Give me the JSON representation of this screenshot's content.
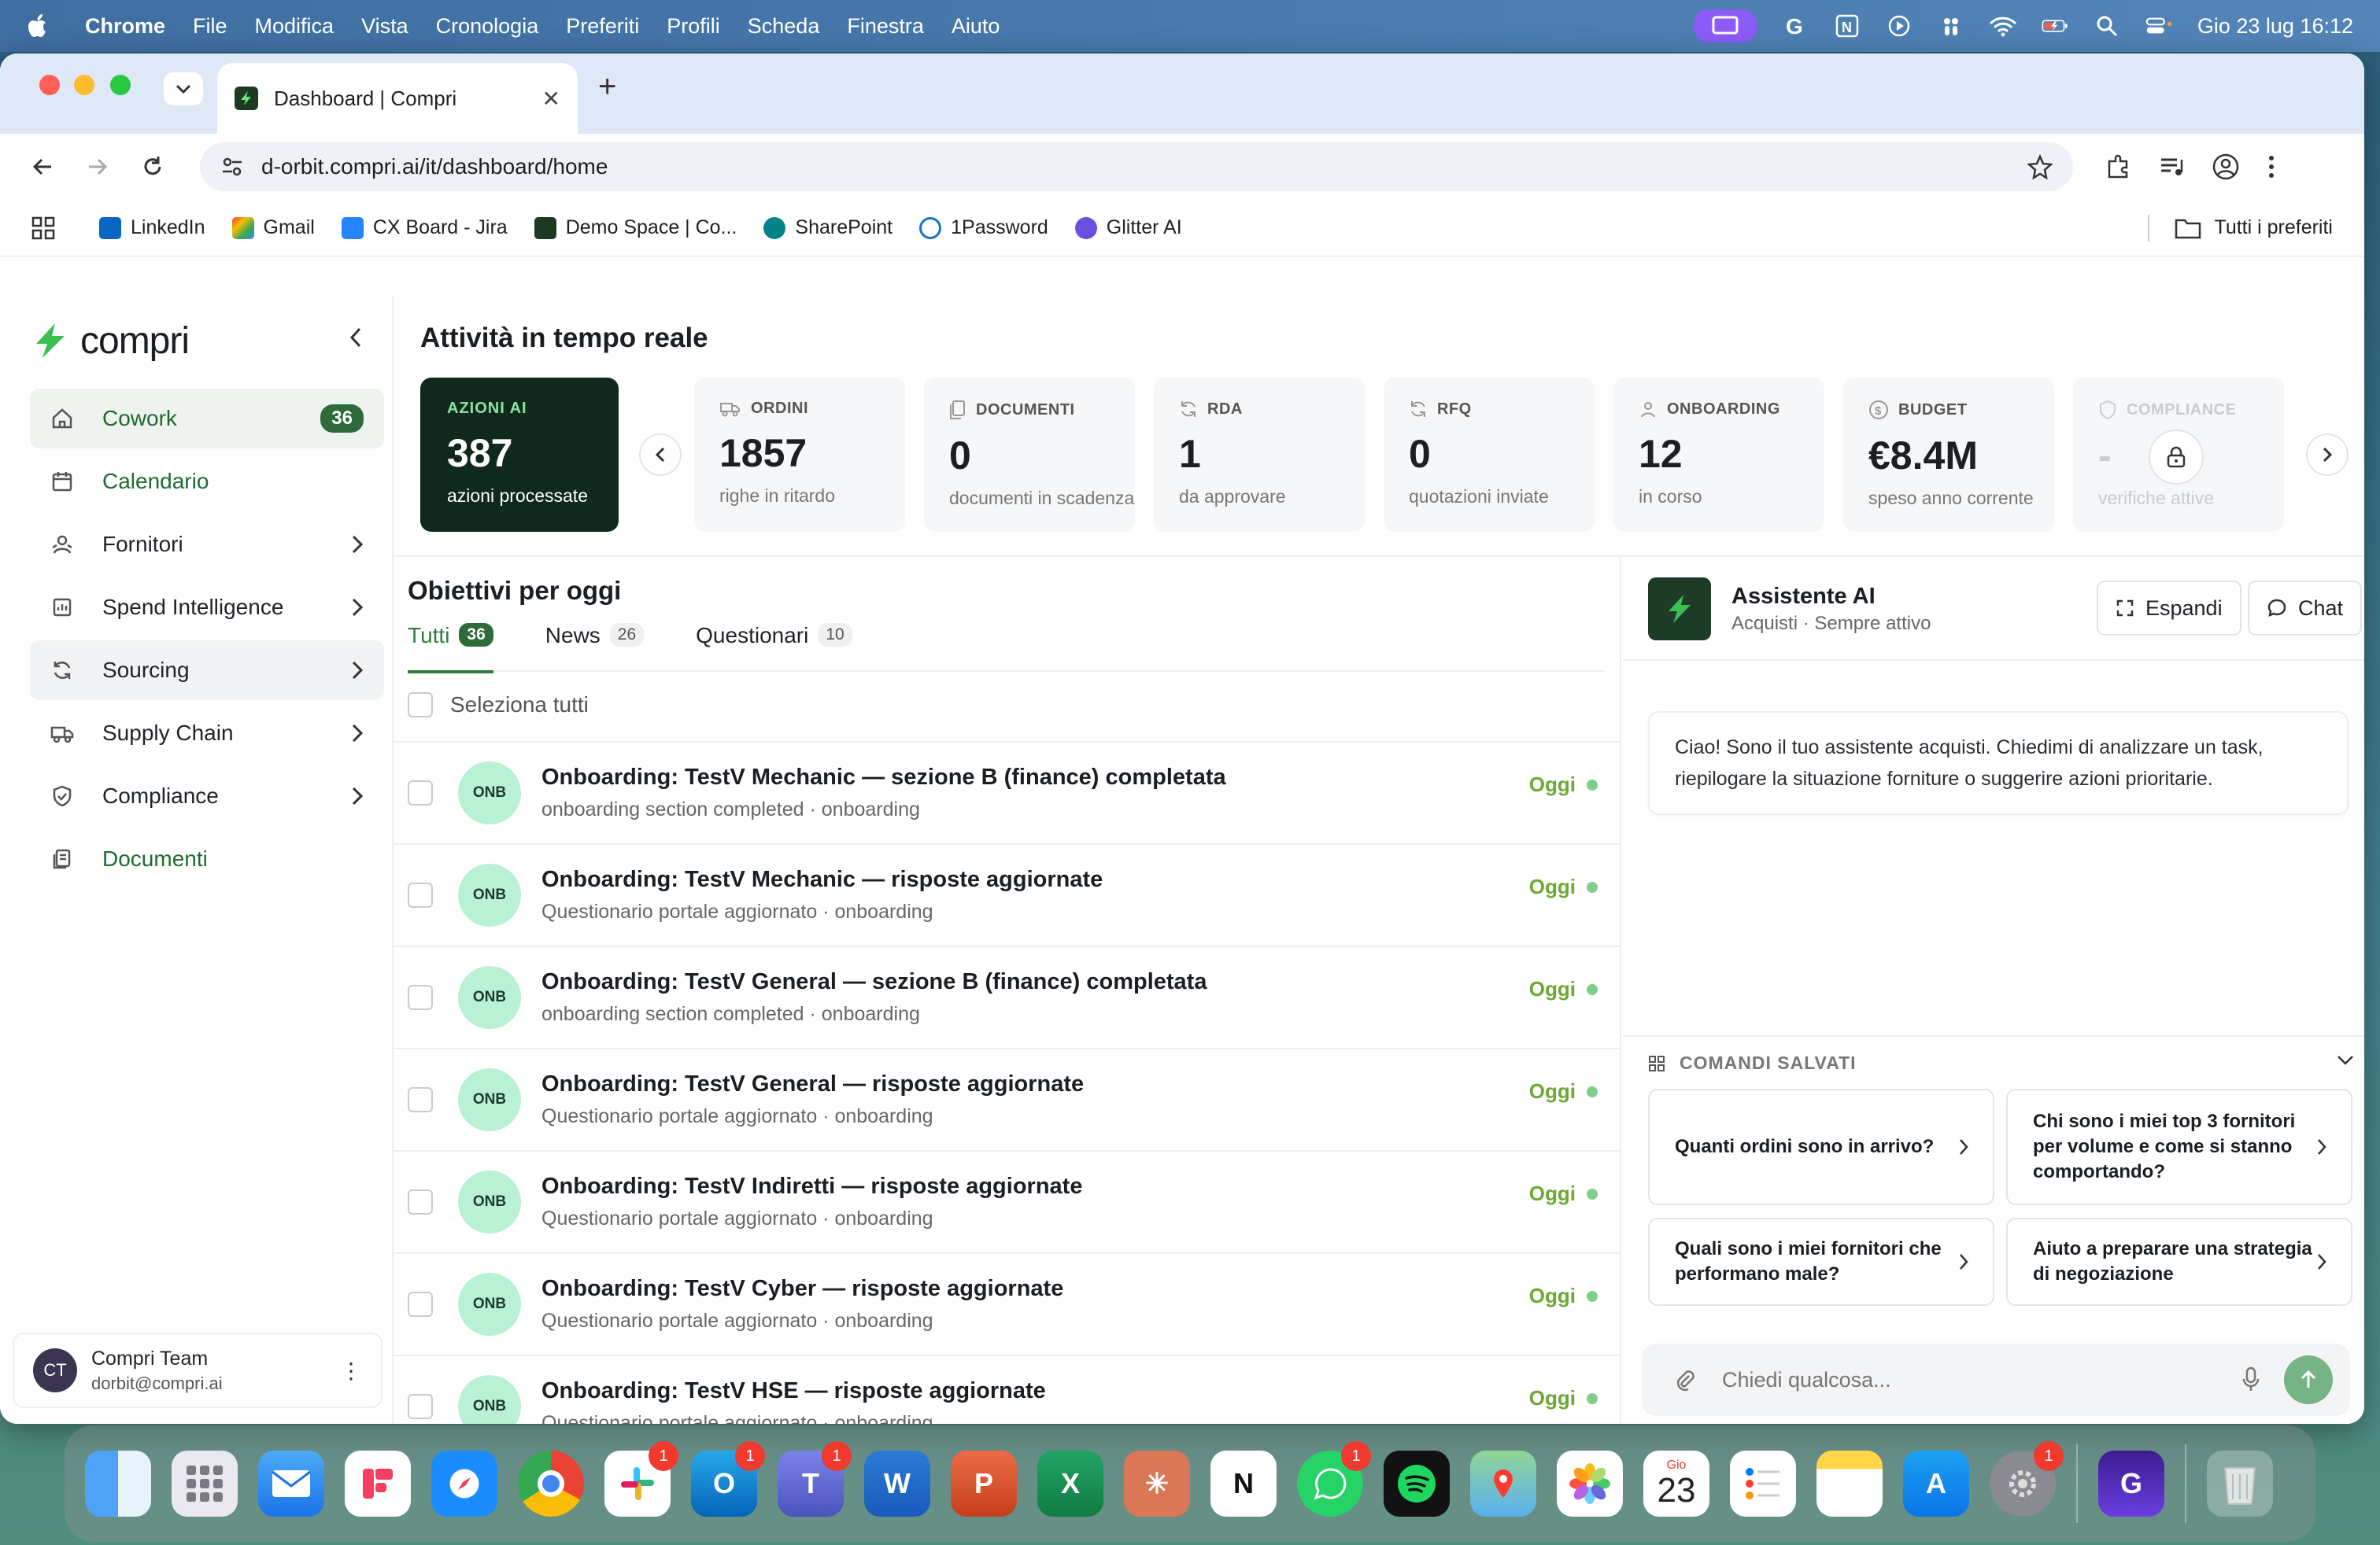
{
  "menubar": {
    "app": "Chrome",
    "items": [
      "File",
      "Modifica",
      "Vista",
      "Cronologia",
      "Preferiti",
      "Profili",
      "Scheda",
      "Finestra",
      "Aiuto"
    ],
    "clock": "Gio 23 lug  16:12"
  },
  "browser": {
    "tab_title": "Dashboard | Compri",
    "url": "d-orbit.compri.ai/it/dashboard/home",
    "bookmarks": [
      "LinkedIn",
      "Gmail",
      "CX Board - Jira",
      "Demo Space | Co...",
      "SharePoint",
      "1Password",
      "Glitter AI"
    ],
    "all_bookmarks": "Tutti i preferiti"
  },
  "sidebar": {
    "brand": "compri",
    "items": [
      {
        "label": "Cowork",
        "badge": "36"
      },
      {
        "label": "Calendario"
      },
      {
        "label": "Fornitori"
      },
      {
        "label": "Spend Intelligence"
      },
      {
        "label": "Sourcing"
      },
      {
        "label": "Supply Chain"
      },
      {
        "label": "Compliance"
      },
      {
        "label": "Documenti"
      }
    ],
    "user": {
      "initials": "CT",
      "name": "Compri Team",
      "email": "dorbit@compri.ai"
    }
  },
  "realtime": {
    "title": "Attività in tempo reale",
    "ai": {
      "caption": "AZIONI AI",
      "value": "387",
      "sub": "azioni processate"
    },
    "kpis": [
      {
        "caption": "ORDINI",
        "value": "1857",
        "sub": "righe in ritardo"
      },
      {
        "caption": "DOCUMENTI",
        "value": "0",
        "sub": "documenti in scadenza"
      },
      {
        "caption": "RDA",
        "value": "1",
        "sub": "da approvare"
      },
      {
        "caption": "RFQ",
        "value": "0",
        "sub": "quotazioni inviate"
      },
      {
        "caption": "ONBOARDING",
        "value": "12",
        "sub": "in corso"
      },
      {
        "caption": "BUDGET",
        "value": "€8.4M",
        "sub": "speso anno corrente"
      },
      {
        "caption": "COMPLIANCE",
        "value": "-",
        "sub": "verifiche attive"
      }
    ]
  },
  "objectives": {
    "title": "Obiettivi per oggi",
    "tabs": [
      {
        "label": "Tutti",
        "count": "36"
      },
      {
        "label": "News",
        "count": "26"
      },
      {
        "label": "Questionari",
        "count": "10"
      }
    ],
    "select_all": "Seleziona tutti",
    "avatar_label": "ONB",
    "rows": [
      {
        "title": "Onboarding: TestV Mechanic — sezione B (finance) completata",
        "sub": "onboarding section completed · onboarding",
        "when": "Oggi"
      },
      {
        "title": "Onboarding: TestV Mechanic — risposte aggiornate",
        "sub": "Questionario portale aggiornato · onboarding",
        "when": "Oggi"
      },
      {
        "title": "Onboarding: TestV General — sezione B (finance) completata",
        "sub": "onboarding section completed · onboarding",
        "when": "Oggi"
      },
      {
        "title": "Onboarding: TestV General — risposte aggiornate",
        "sub": "Questionario portale aggiornato · onboarding",
        "when": "Oggi"
      },
      {
        "title": "Onboarding: TestV Indiretti — risposte aggiornate",
        "sub": "Questionario portale aggiornato · onboarding",
        "when": "Oggi"
      },
      {
        "title": "Onboarding: TestV Cyber — risposte aggiornate",
        "sub": "Questionario portale aggiornato · onboarding",
        "when": "Oggi"
      },
      {
        "title": "Onboarding: TestV HSE — risposte aggiornate",
        "sub": "Questionario portale aggiornato · onboarding",
        "when": "Oggi"
      }
    ]
  },
  "assistant": {
    "title": "Assistente AI",
    "sub": "Acquisti · Sempre attivo",
    "expand": "Espandi",
    "chat": "Chat",
    "greeting": "Ciao! Sono il tuo assistente acquisti. Chiedimi di analizzare un task, riepilogare la situazione forniture o suggerire azioni prioritarie.",
    "saved_label": "COMANDI SALVATI",
    "commands": [
      "Quanti ordini sono in arrivo?",
      "Chi sono i miei top 3 fornitori per volume e come si stanno comportando?",
      "Quali sono i miei fornitori che performano male?",
      "Aiuto a preparare una strategia di negoziazione"
    ],
    "input_placeholder": "Chiedi qualcosa..."
  },
  "dock": {
    "calendar_month": "Gio",
    "calendar_day": "23",
    "badges": [
      "1",
      "1",
      "1",
      "1",
      "1"
    ]
  },
  "colors": {
    "brand_green": "#2f6b3a",
    "accent_green": "#2f7d3a",
    "onb_bg": "#b9f1d4",
    "dark_card": "#0f2a1c"
  }
}
